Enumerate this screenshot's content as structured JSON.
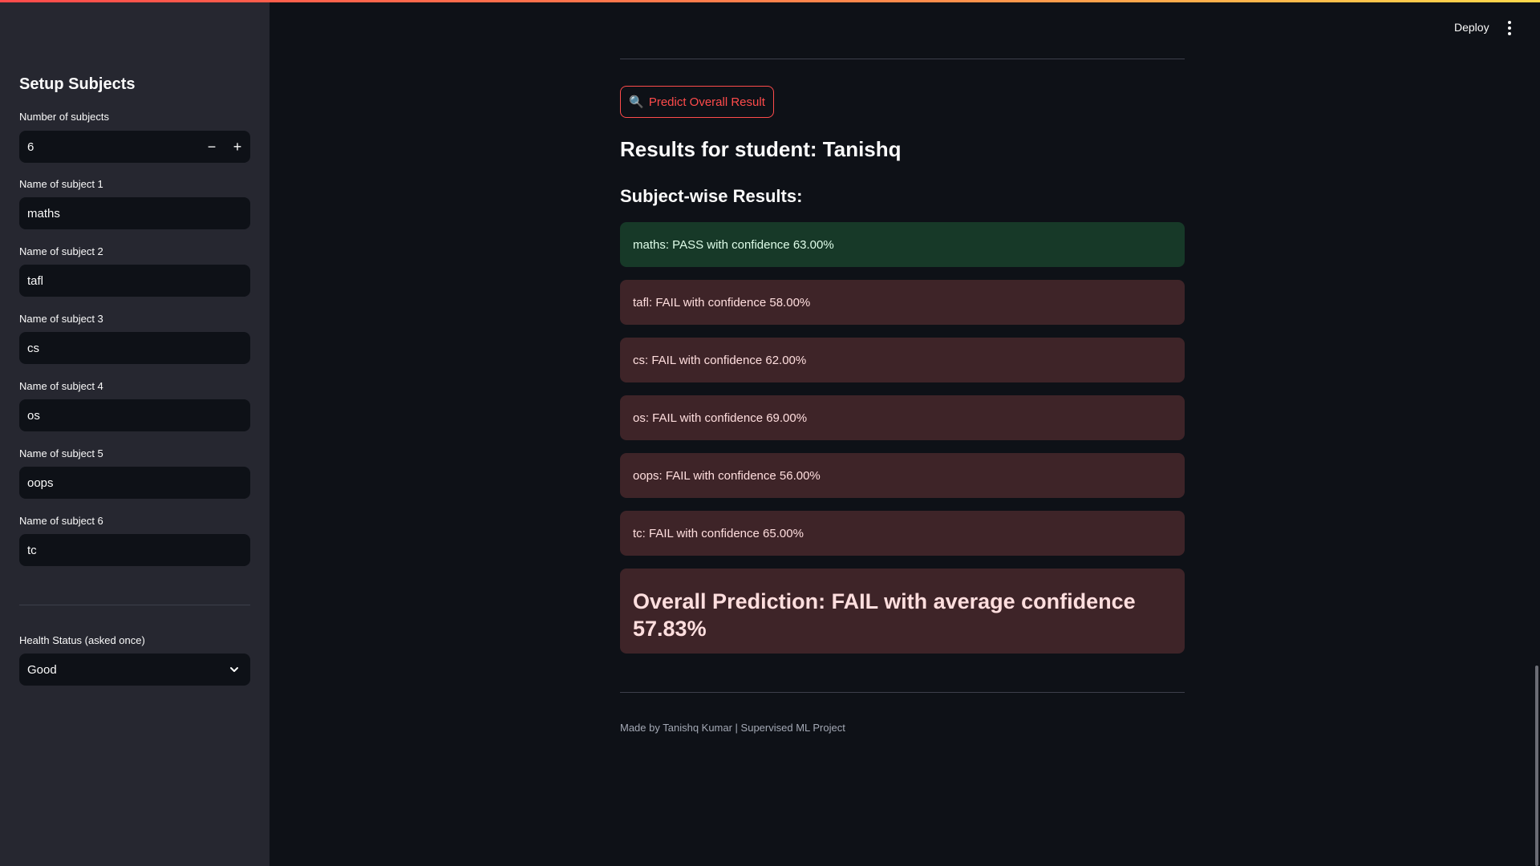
{
  "header": {
    "deploy_label": "Deploy",
    "menu_icon": "kebab-menu-icon"
  },
  "sidebar": {
    "title": "Setup Subjects",
    "num_subjects": {
      "label": "Number of subjects",
      "value": "6",
      "decrement": "−",
      "increment": "+"
    },
    "subjects": [
      {
        "label": "Name of subject 1",
        "value": "maths"
      },
      {
        "label": "Name of subject 2",
        "value": "tafl"
      },
      {
        "label": "Name of subject 3",
        "value": "cs"
      },
      {
        "label": "Name of subject 4",
        "value": "os"
      },
      {
        "label": "Name of subject 5",
        "value": "oops"
      },
      {
        "label": "Name of subject 6",
        "value": "tc"
      }
    ],
    "health": {
      "label": "Health Status (asked once)",
      "value": "Good",
      "chevron_icon": "chevron-down-icon"
    }
  },
  "main": {
    "predict_button": {
      "icon": "🔍",
      "label": "Predict Overall Result"
    },
    "results_title": "Results for student: Tanishq",
    "subject_results_title": "Subject-wise Results:",
    "results": [
      {
        "text": "maths: PASS with confidence 63.00%",
        "status": "pass"
      },
      {
        "text": "tafl: FAIL with confidence 58.00%",
        "status": "fail"
      },
      {
        "text": "cs: FAIL with confidence 62.00%",
        "status": "fail"
      },
      {
        "text": "os: FAIL with confidence 69.00%",
        "status": "fail"
      },
      {
        "text": "oops: FAIL with confidence 56.00%",
        "status": "fail"
      },
      {
        "text": "tc: FAIL with confidence 65.00%",
        "status": "fail"
      }
    ],
    "overall": "Overall Prediction: FAIL with average confidence 57.83%",
    "footer": "Made by Tanishq Kumar | Supervised ML Project"
  },
  "colors": {
    "accent": "#ff4b4b",
    "pass_bg": "#173928",
    "fail_bg": "#3e2428",
    "app_bg": "#0e1117",
    "sidebar_bg": "#262730"
  }
}
